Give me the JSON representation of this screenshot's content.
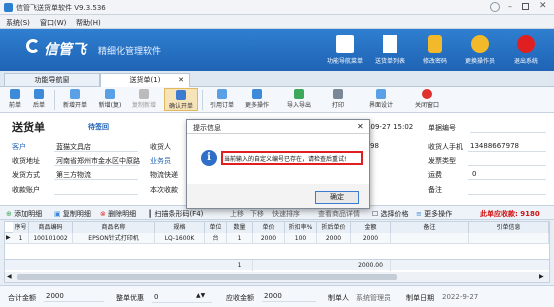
{
  "window": {
    "title": "信管飞送货单软件 V9.3.536"
  },
  "menu": [
    "系统(S)",
    "窗口(W)",
    "帮助(H)"
  ],
  "banner": {
    "logo_text": "信管飞",
    "slogan": "精细化管理软件",
    "buttons": [
      "功能导航菜单",
      "送货单列表",
      "修改密码",
      "更换操作员",
      "退出系统"
    ]
  },
  "tabs": [
    "功能导航窗",
    "送货单(1)"
  ],
  "toolbar": [
    "前单",
    "后单",
    "新增开单",
    "新增(复)",
    "复制新增",
    "确认开单",
    "引用订单",
    "更多操作",
    "导入导出",
    "打印",
    "界面设计",
    "关闭窗口"
  ],
  "form": {
    "title": "送货单",
    "status": "待签回",
    "customer_label": "客户",
    "customer": "蓝猫文具店",
    "address_label": "收货地址",
    "address": "河南省郑州市金水区中原路",
    "ship_label": "发货方式",
    "ship": "第三方物流",
    "account_label": "收款账户",
    "receiver_label": "收货人",
    "sales_label": "业务员",
    "logistics_label": "物流快递",
    "this_label": "本次收款",
    "date": "-09-27 15:02",
    "docno_label": "单据编号",
    "phone_label": "收货人手机",
    "phone": "13488667978",
    "invoice_label": "发票类型",
    "freight_label": "运费",
    "freight": "0",
    "note_label": "备注",
    "partial_left": "98"
  },
  "rowbar": [
    "添加明细",
    "复制明细",
    "删除明细",
    "扫描条形码(F4)",
    "上移",
    "下移",
    "快速排序",
    "查看商品详情",
    "选择价格",
    "更多操作"
  ],
  "rowbar_total": "此单应收款: 9180",
  "grid": {
    "headers": [
      "序号",
      "商品编码",
      "商品名称",
      "规格",
      "单位",
      "数量",
      "单价",
      "折扣率%",
      "折后单价",
      "金额",
      "备注",
      "引单信息"
    ],
    "rows": [
      [
        "1",
        "100101002",
        "EPSON针式打印机",
        "LQ-1600K",
        "台",
        "1",
        "2000",
        "100",
        "2000",
        "2000",
        "",
        ""
      ]
    ],
    "total_qty": "1",
    "total_amount": "2000.00"
  },
  "footer": {
    "total_label": "合计金额",
    "total": "2000",
    "discount_label": "整单优惠",
    "discount": "0",
    "receivable_label": "应收金额",
    "receivable": "2000",
    "maker_label": "制单人",
    "maker": "系统管理员",
    "date_label": "制单日期",
    "date": "2022-9-27"
  },
  "dialog": {
    "title": "提示信息",
    "message": "当前输入的自定义编号已存在，请检查后重试!",
    "ok": "确定"
  },
  "colors": {
    "banner": "#1f63b4",
    "accent_red": "#e02020",
    "total_red": "#d01010"
  }
}
